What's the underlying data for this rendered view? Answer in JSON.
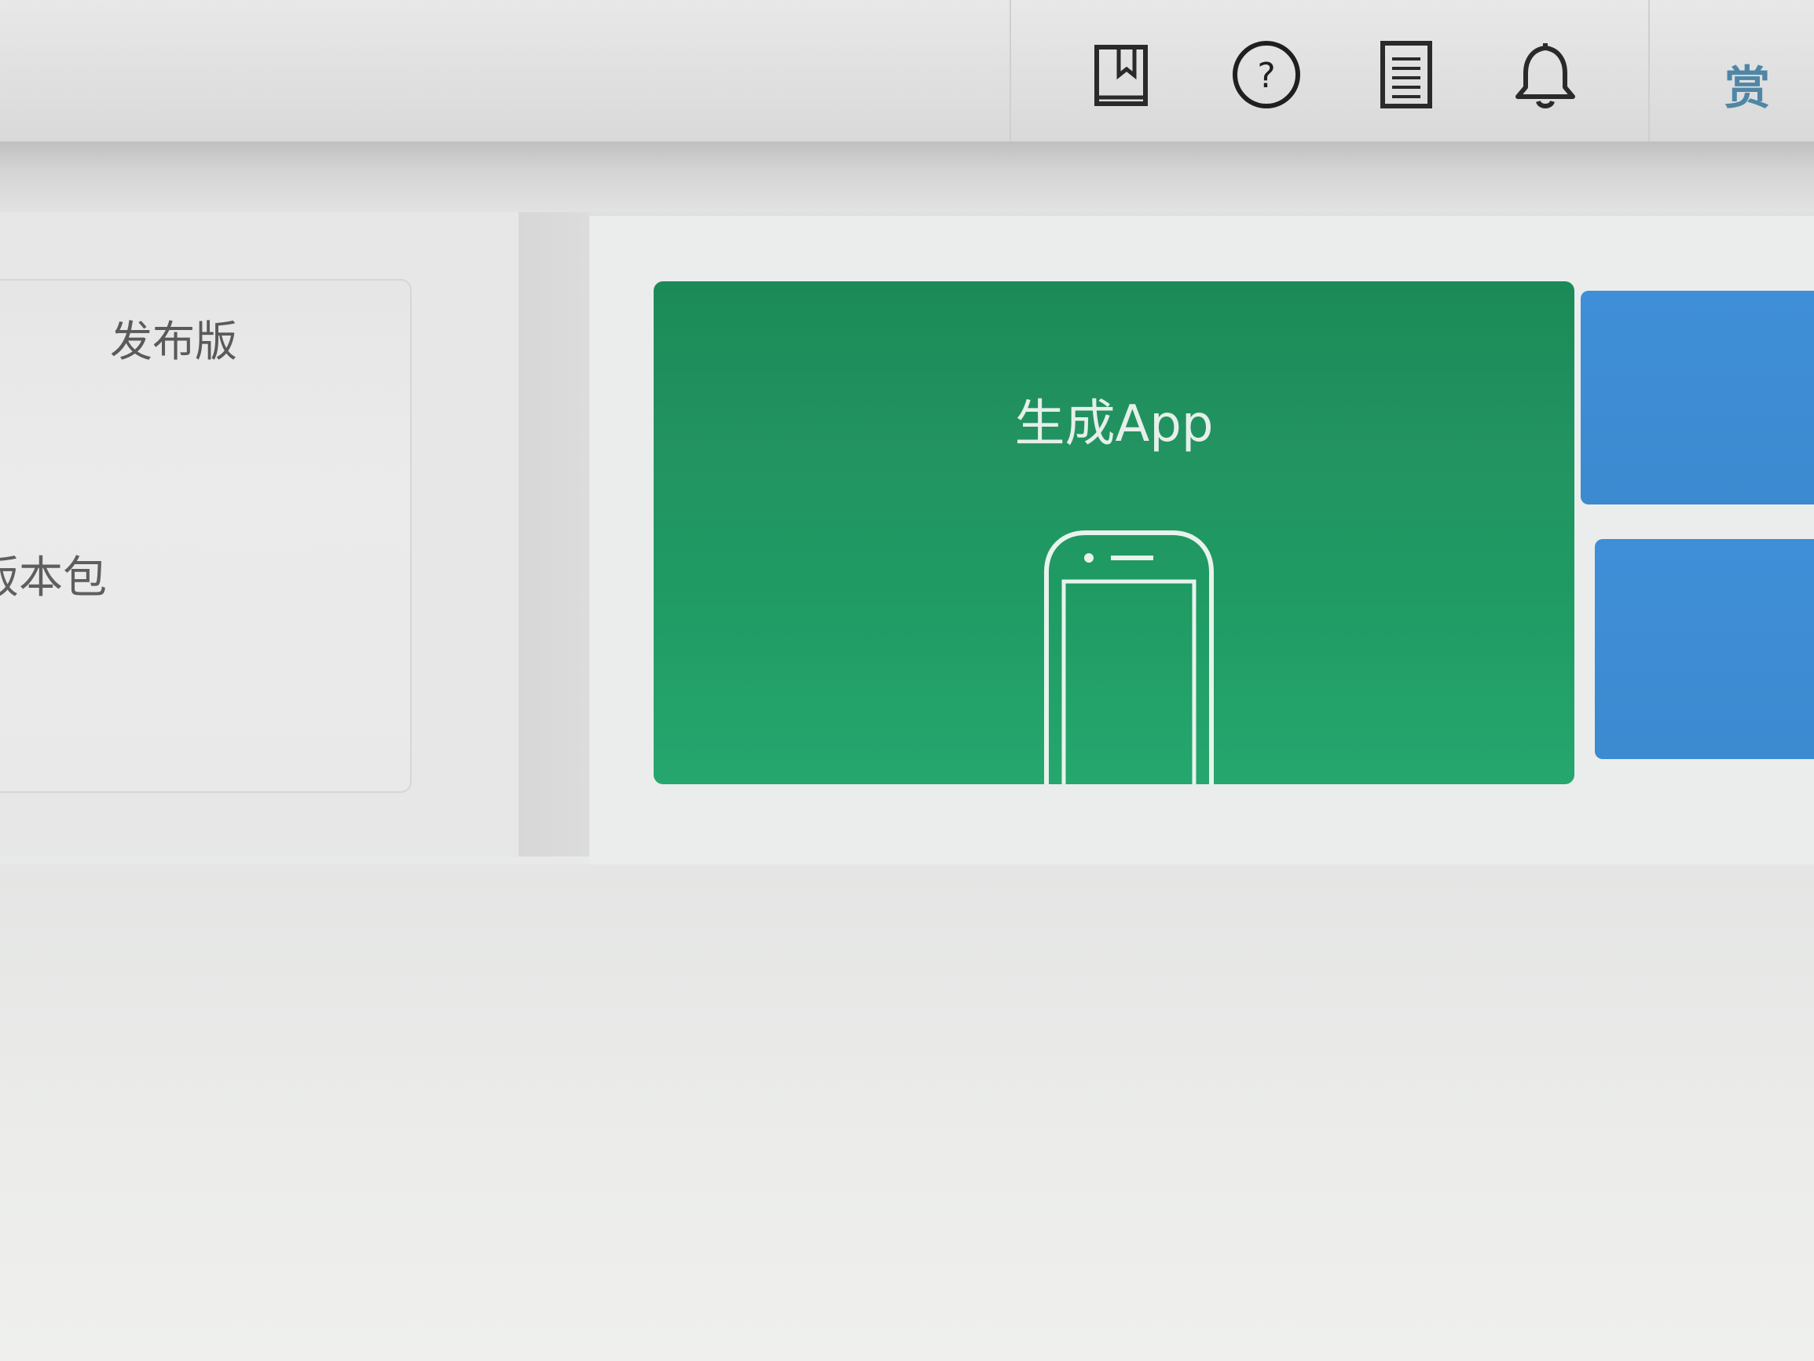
{
  "toolbar": {
    "icons": [
      "book-icon",
      "help-icon",
      "document-icon",
      "bell-icon"
    ],
    "reward_label": "赏"
  },
  "versions": {
    "release_label": "发布版",
    "package_label": "版本包"
  },
  "actions": {
    "generate_app_label": "生成App"
  },
  "colors": {
    "green_card": "#229462",
    "blue_card": "#3f8fd8",
    "reward_text": "#4f86a6"
  }
}
